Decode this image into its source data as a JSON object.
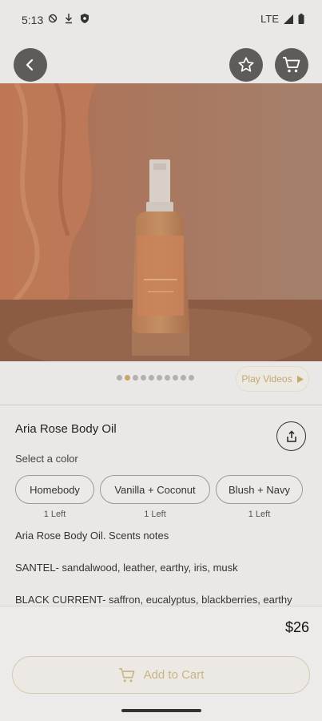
{
  "status_bar": {
    "time": "5:13",
    "network": "LTE"
  },
  "header": {
    "back_icon": "chevron-left-icon",
    "favorite_icon": "star-icon",
    "cart_icon": "cart-icon"
  },
  "carousel": {
    "total_dots": 10,
    "active_index": 1,
    "play_videos_label": "Play Videos"
  },
  "product": {
    "title": "Aria Rose Body Oil",
    "select_color_label": "Select a color",
    "variants": [
      {
        "label": "Homebody",
        "stock": "1 Left"
      },
      {
        "label": "Vanilla + Coconut",
        "stock": "1 Left"
      },
      {
        "label": "Blush + Navy",
        "stock": "1 Left"
      }
    ],
    "description": [
      "Aria Rose Body Oil. Scents notes",
      "SANTEL- sandalwood, leather, earthy, iris,  musk",
      "BLACK CURRENT- saffron, eucalyptus, blackberries, earthy"
    ],
    "price": "$26",
    "add_to_cart_label": "Add to Cart"
  },
  "colors": {
    "accent": "#c8a86a",
    "header_button_bg": "#5d5c5b"
  }
}
